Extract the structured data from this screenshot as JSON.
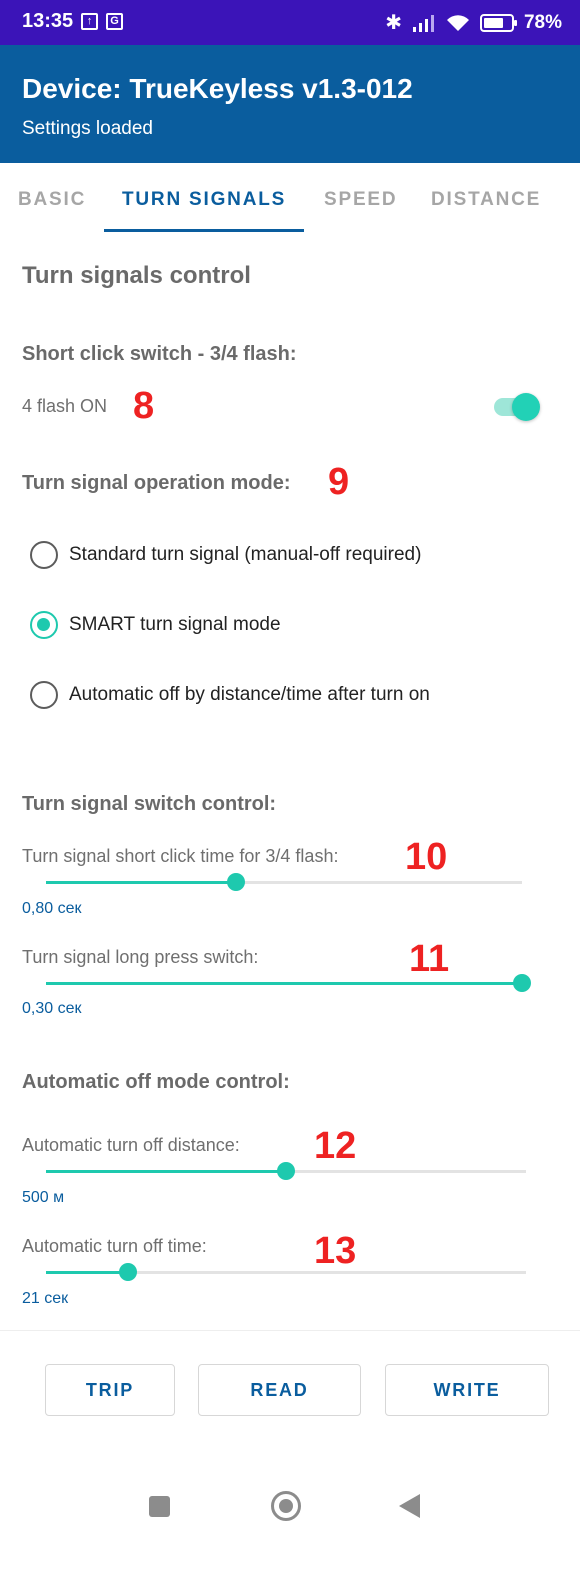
{
  "status_bar": {
    "time": "13:35",
    "battery": "78%",
    "battery_level": 0.78,
    "icons": [
      "upload-icon",
      "translate-icon",
      "bluetooth-icon",
      "signal-icon",
      "wifi-icon",
      "battery-icon"
    ]
  },
  "app_bar": {
    "title": "Device: TrueKeyless v1.3-012",
    "subtitle": "Settings loaded"
  },
  "tabs": [
    {
      "label": "BASIC",
      "active": false
    },
    {
      "label": "TURN SIGNALS",
      "active": true
    },
    {
      "label": "SPEED",
      "active": false
    },
    {
      "label": "DISTANCE",
      "active": false
    }
  ],
  "section_title": "Turn signals control",
  "short_click": {
    "heading": "Short click switch - 3/4 flash:",
    "state_label": "4 flash ON",
    "enabled": true
  },
  "operation_mode": {
    "heading": "Turn signal operation mode:",
    "options": [
      {
        "label": "Standard turn signal (manual-off required)",
        "selected": false
      },
      {
        "label": "SMART turn signal mode",
        "selected": true
      },
      {
        "label": "Automatic off by distance/time after turn on",
        "selected": false
      }
    ]
  },
  "switch_control": {
    "heading": "Turn signal switch control:",
    "short_click_time": {
      "label": "Turn signal short click time for 3/4 flash:",
      "value_text": "0,80 сек",
      "position": 0.4
    },
    "long_press": {
      "label": "Turn signal long press switch:",
      "value_text": "0,30 сек",
      "position": 1.0
    }
  },
  "auto_off": {
    "heading": "Automatic off mode control:",
    "distance": {
      "label": "Automatic turn off distance:",
      "value_text": "500 м",
      "position": 0.5
    },
    "time": {
      "label": "Automatic turn off time:",
      "value_text": "21 сек",
      "position": 0.17
    }
  },
  "annotations": [
    "8",
    "9",
    "10",
    "11",
    "12",
    "13"
  ],
  "buttons": {
    "trip": "TRIP",
    "read": "READ",
    "write": "WRITE"
  },
  "colors": {
    "status_bar": "#3b14b8",
    "app_bar": "#0a5d9e",
    "accent": "#1ec9ae",
    "annotation": "#ee2222"
  }
}
